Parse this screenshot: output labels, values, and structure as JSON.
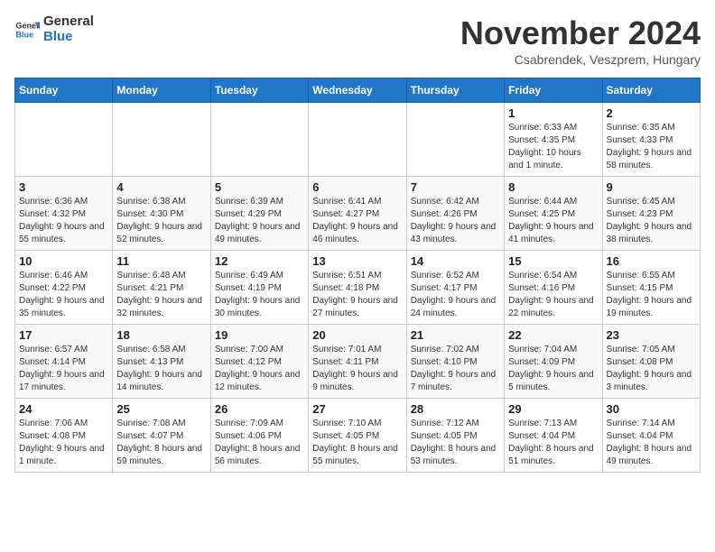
{
  "logo": {
    "line1": "General",
    "line2": "Blue"
  },
  "title": "November 2024",
  "subtitle": "Csabrendek, Veszprem, Hungary",
  "weekdays": [
    "Sunday",
    "Monday",
    "Tuesday",
    "Wednesday",
    "Thursday",
    "Friday",
    "Saturday"
  ],
  "weeks": [
    [
      {
        "day": "",
        "info": ""
      },
      {
        "day": "",
        "info": ""
      },
      {
        "day": "",
        "info": ""
      },
      {
        "day": "",
        "info": ""
      },
      {
        "day": "",
        "info": ""
      },
      {
        "day": "1",
        "info": "Sunrise: 6:33 AM\nSunset: 4:35 PM\nDaylight: 10 hours and 1 minute."
      },
      {
        "day": "2",
        "info": "Sunrise: 6:35 AM\nSunset: 4:33 PM\nDaylight: 9 hours and 58 minutes."
      }
    ],
    [
      {
        "day": "3",
        "info": "Sunrise: 6:36 AM\nSunset: 4:32 PM\nDaylight: 9 hours and 55 minutes."
      },
      {
        "day": "4",
        "info": "Sunrise: 6:38 AM\nSunset: 4:30 PM\nDaylight: 9 hours and 52 minutes."
      },
      {
        "day": "5",
        "info": "Sunrise: 6:39 AM\nSunset: 4:29 PM\nDaylight: 9 hours and 49 minutes."
      },
      {
        "day": "6",
        "info": "Sunrise: 6:41 AM\nSunset: 4:27 PM\nDaylight: 9 hours and 46 minutes."
      },
      {
        "day": "7",
        "info": "Sunrise: 6:42 AM\nSunset: 4:26 PM\nDaylight: 9 hours and 43 minutes."
      },
      {
        "day": "8",
        "info": "Sunrise: 6:44 AM\nSunset: 4:25 PM\nDaylight: 9 hours and 41 minutes."
      },
      {
        "day": "9",
        "info": "Sunrise: 6:45 AM\nSunset: 4:23 PM\nDaylight: 9 hours and 38 minutes."
      }
    ],
    [
      {
        "day": "10",
        "info": "Sunrise: 6:46 AM\nSunset: 4:22 PM\nDaylight: 9 hours and 35 minutes."
      },
      {
        "day": "11",
        "info": "Sunrise: 6:48 AM\nSunset: 4:21 PM\nDaylight: 9 hours and 32 minutes."
      },
      {
        "day": "12",
        "info": "Sunrise: 6:49 AM\nSunset: 4:19 PM\nDaylight: 9 hours and 30 minutes."
      },
      {
        "day": "13",
        "info": "Sunrise: 6:51 AM\nSunset: 4:18 PM\nDaylight: 9 hours and 27 minutes."
      },
      {
        "day": "14",
        "info": "Sunrise: 6:52 AM\nSunset: 4:17 PM\nDaylight: 9 hours and 24 minutes."
      },
      {
        "day": "15",
        "info": "Sunrise: 6:54 AM\nSunset: 4:16 PM\nDaylight: 9 hours and 22 minutes."
      },
      {
        "day": "16",
        "info": "Sunrise: 6:55 AM\nSunset: 4:15 PM\nDaylight: 9 hours and 19 minutes."
      }
    ],
    [
      {
        "day": "17",
        "info": "Sunrise: 6:57 AM\nSunset: 4:14 PM\nDaylight: 9 hours and 17 minutes."
      },
      {
        "day": "18",
        "info": "Sunrise: 6:58 AM\nSunset: 4:13 PM\nDaylight: 9 hours and 14 minutes."
      },
      {
        "day": "19",
        "info": "Sunrise: 7:00 AM\nSunset: 4:12 PM\nDaylight: 9 hours and 12 minutes."
      },
      {
        "day": "20",
        "info": "Sunrise: 7:01 AM\nSunset: 4:11 PM\nDaylight: 9 hours and 9 minutes."
      },
      {
        "day": "21",
        "info": "Sunrise: 7:02 AM\nSunset: 4:10 PM\nDaylight: 9 hours and 7 minutes."
      },
      {
        "day": "22",
        "info": "Sunrise: 7:04 AM\nSunset: 4:09 PM\nDaylight: 9 hours and 5 minutes."
      },
      {
        "day": "23",
        "info": "Sunrise: 7:05 AM\nSunset: 4:08 PM\nDaylight: 9 hours and 3 minutes."
      }
    ],
    [
      {
        "day": "24",
        "info": "Sunrise: 7:06 AM\nSunset: 4:08 PM\nDaylight: 9 hours and 1 minute."
      },
      {
        "day": "25",
        "info": "Sunrise: 7:08 AM\nSunset: 4:07 PM\nDaylight: 8 hours and 59 minutes."
      },
      {
        "day": "26",
        "info": "Sunrise: 7:09 AM\nSunset: 4:06 PM\nDaylight: 8 hours and 56 minutes."
      },
      {
        "day": "27",
        "info": "Sunrise: 7:10 AM\nSunset: 4:05 PM\nDaylight: 8 hours and 55 minutes."
      },
      {
        "day": "28",
        "info": "Sunrise: 7:12 AM\nSunset: 4:05 PM\nDaylight: 8 hours and 53 minutes."
      },
      {
        "day": "29",
        "info": "Sunrise: 7:13 AM\nSunset: 4:04 PM\nDaylight: 8 hours and 51 minutes."
      },
      {
        "day": "30",
        "info": "Sunrise: 7:14 AM\nSunset: 4:04 PM\nDaylight: 8 hours and 49 minutes."
      }
    ]
  ]
}
